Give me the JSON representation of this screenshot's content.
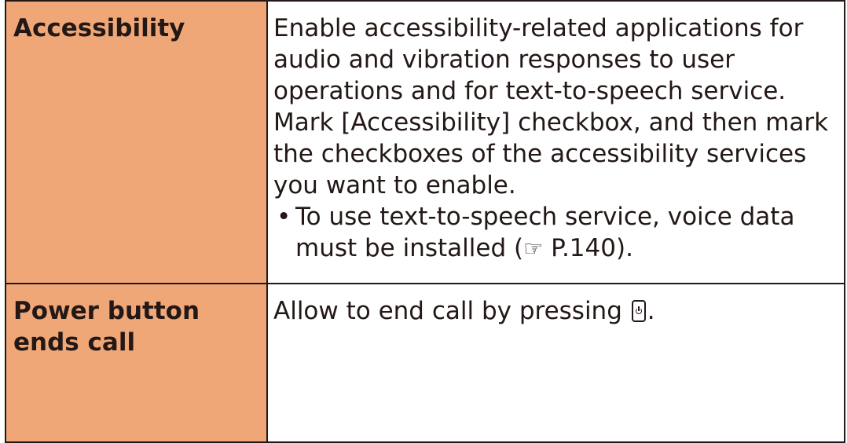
{
  "table": {
    "rows": [
      {
        "name": "Accessibility",
        "description": "Enable accessibility-related applications for audio and vibration responses to user operations and for text-to-speech service. Mark [Accessibility] checkbox, and then mark the checkboxes of the accessibility services you want to enable.",
        "bullets": [
          {
            "marker": "•",
            "text_before": "To use text-to-speech service, voice data must be installed (",
            "ref_icon": "☞",
            "ref_page": " P.140",
            "text_after": ")."
          }
        ]
      },
      {
        "name": "Power button\nends call",
        "description_before": "Allow to end call by pressing ",
        "key_icon": "power-key-icon",
        "description_after": "."
      }
    ]
  }
}
